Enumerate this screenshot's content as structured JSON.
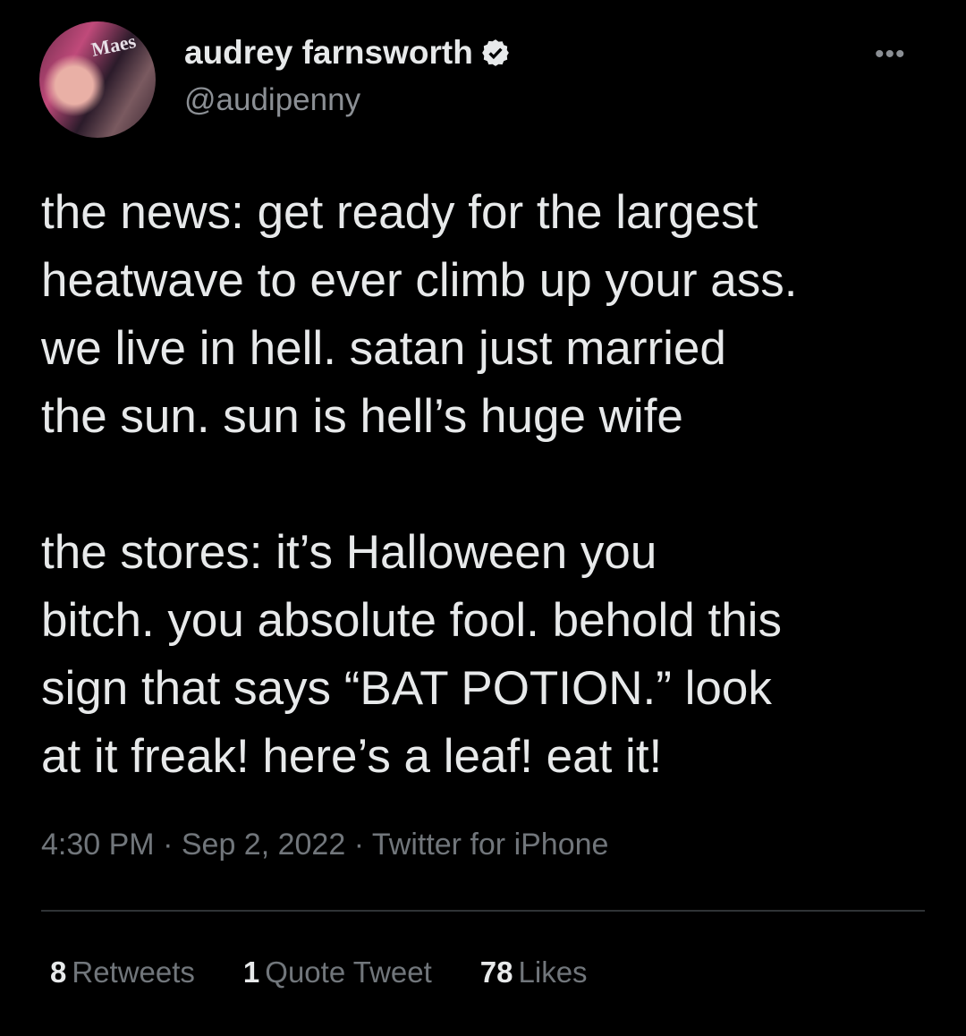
{
  "author": {
    "name": "audrey farnsworth",
    "handle": "@audipenny",
    "verified": true,
    "avatar_sign_text": "Maes"
  },
  "icons": {
    "verified": "verified-badge-icon",
    "more": "more-options-icon"
  },
  "more_label": "•••",
  "tweet": {
    "paragraphs": [
      [
        "the news: get ready for the largest",
        "heatwave to ever climb up your ass.",
        "we live in hell. satan just married",
        "the sun. sun is hell’s huge wife"
      ],
      [
        "the stores: it’s Halloween you",
        "bitch. you absolute fool. behold this",
        "sign that says “BAT POTION.” look",
        "at it freak! here’s a leaf! eat it!"
      ]
    ],
    "time": "4:30 PM",
    "date": "Sep 2, 2022",
    "source": "Twitter for iPhone",
    "separator": "·"
  },
  "stats": {
    "retweets": {
      "count": "8",
      "label": "Retweets"
    },
    "quotes": {
      "count": "1",
      "label": "Quote Tweet"
    },
    "likes": {
      "count": "78",
      "label": "Likes"
    }
  },
  "colors": {
    "background": "#000000",
    "text": "#e7e9ea",
    "secondary": "#71767b",
    "divider": "#2f3336"
  }
}
